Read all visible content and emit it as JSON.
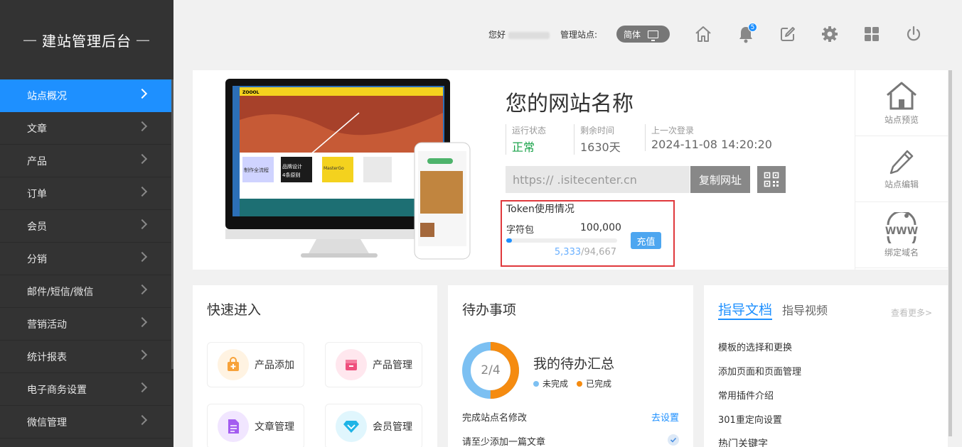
{
  "sidebar": {
    "brand": "建站管理后台",
    "dash": "—",
    "items": [
      {
        "label": "站点概况",
        "active": true
      },
      {
        "label": "文章"
      },
      {
        "label": "产品"
      },
      {
        "label": "订单"
      },
      {
        "label": "会员"
      },
      {
        "label": "分销"
      },
      {
        "label": "邮件/短信/微信"
      },
      {
        "label": "营销活动"
      },
      {
        "label": "统计报表"
      },
      {
        "label": "电子商务设置"
      },
      {
        "label": "微信管理"
      }
    ]
  },
  "topbar": {
    "greeting": "您好",
    "manage_label": "管理站点:",
    "language": "简体",
    "notification_count": "5",
    "icons": [
      "home-icon",
      "bell-icon",
      "edit-icon",
      "gear-icon",
      "grid-icon",
      "power-icon"
    ]
  },
  "site": {
    "title": "您的网站名称",
    "status_label": "运行状态",
    "status_value": "正常",
    "remain_label": "剩余时间",
    "remain_value": "1630天",
    "login_label": "上一次登录",
    "login_value": "2024-11-08 14:20:20",
    "url": "https://     .isitecenter.cn",
    "copy_label": "复制网址",
    "mock_brand": "ZOOOL",
    "mock_badges": [
      "制作全流程",
      "品牌设计",
      "4条原则",
      "MasterGo"
    ]
  },
  "token": {
    "title": "Token使用情况",
    "package_label": "字符包",
    "package_value": "100,000",
    "used": "5,333",
    "remaining": "/94,667",
    "used_fraction": 0.053,
    "recharge_label": "充值"
  },
  "side_actions": [
    {
      "label": "站点预览",
      "icon": "house-icon"
    },
    {
      "label": "站点编辑",
      "icon": "pencil-icon"
    },
    {
      "label": "绑定域名",
      "icon": "www-icon"
    }
  ],
  "quick": {
    "title": "快速进入",
    "items": [
      {
        "label": "产品添加",
        "color": "#f7a23a",
        "bg": "#fff3e2"
      },
      {
        "label": "产品管理",
        "color": "#ef4f7d",
        "bg": "#ffe7ee"
      },
      {
        "label": "文章管理",
        "color": "#a35cf0",
        "bg": "#f1e6ff"
      },
      {
        "label": "会员管理",
        "color": "#1fb4e6",
        "bg": "#e0f6fd"
      }
    ]
  },
  "todo": {
    "title": "待办事项",
    "summary_title": "我的待办汇总",
    "ratio": "2/4",
    "done_fraction": 0.5,
    "legend_undone": "未完成",
    "legend_done": "已完成",
    "color_undone": "#7cc0f2",
    "color_done": "#f58b10",
    "rows": [
      {
        "label": "完成站点名修改",
        "action": "去设置"
      },
      {
        "label": "请至少添加一篇文章",
        "done": true
      }
    ]
  },
  "docs": {
    "tab_active": "指导文档",
    "tab_other": "指导视频",
    "more": "查看更多>",
    "items": [
      "模板的选择和更换",
      "添加页面和页面管理",
      "常用插件介绍",
      "301重定向设置"
    ],
    "section": "热门关键字"
  }
}
